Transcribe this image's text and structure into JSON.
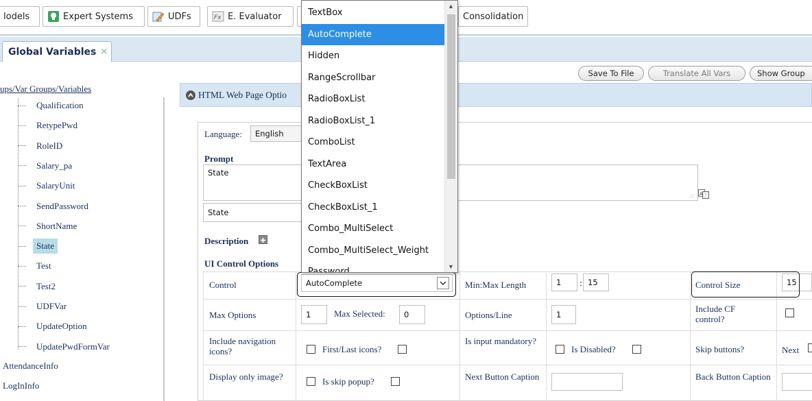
{
  "toolbar": {
    "models": "lodels",
    "expert_systems": "Expert Systems",
    "udfs": "UDFs",
    "evaluator": "E. Evaluator",
    "consolidation": "Consolidation"
  },
  "tabs": {
    "global_variables": "Global Variables",
    "close": "×"
  },
  "tree": {
    "root": "ups/Var Groups/Variables",
    "items": [
      "Qualification",
      "RetypePwd",
      "RoleID",
      "Salary_pa",
      "SalaryUnit",
      "SendPassword",
      "ShortName",
      "State",
      "Test",
      "Test2",
      "UDFVar",
      "UpdateOption",
      "UpdatePwdFormVar"
    ],
    "selected": "State",
    "groups": [
      "AttendanceInfo",
      "LogInInfo"
    ]
  },
  "actions": {
    "save_to_file": "Save To File",
    "translate_all": "Translate All Vars",
    "show_groups": "Show Group"
  },
  "options_header": "HTML Web Page Optio",
  "form": {
    "language_label": "Language:",
    "language_value": "English",
    "prompt_label": "Prompt",
    "prompt_value": "State",
    "short_value": "State",
    "description_label": "Description",
    "ui_options_label": "UI Control Options",
    "control_label": "Control",
    "control_value": "AutoComplete",
    "minmax_label": "Min:Max Length",
    "min_value": "1",
    "max_value": "15",
    "control_size_label": "Control Size",
    "control_size_value": "15",
    "max_options_label": "Max Options",
    "max_options_value": "1",
    "max_selected_label": "Max Selected:",
    "max_selected_value": "0",
    "options_line_label": "Options/Line",
    "options_line_value": "1",
    "include_cf_label": "Include CF control?",
    "include_nav_label": "Include navigation icons?",
    "first_last_label": "First/Last icons?",
    "input_mandatory_label": "Is input mandatory?",
    "is_disabled_label": "Is Disabled?",
    "skip_buttons_label": "Skip buttons?",
    "next_label": "Next",
    "display_only_image_label": "Display only image?",
    "skip_popup_label": "Is skip popup?",
    "next_button_caption_label": "Next Button Caption",
    "back_button_caption_label": "Back Button Caption"
  },
  "dropdown": {
    "items": [
      "TextBox",
      "AutoComplete",
      "Hidden",
      "RangeScrollbar",
      "RadioBoxList",
      "RadioBoxList_1",
      "ComboList",
      "TextArea",
      "CheckBoxList",
      "CheckBoxList_1",
      "Combo_MultiSelect",
      "Combo_MultiSelect_Weight",
      "Password"
    ],
    "selected": "AutoComplete"
  },
  "colors": {
    "selection": "#2d8ee6",
    "header_bg": "#d8e6f3",
    "tree_selected": "#b8dce8"
  }
}
